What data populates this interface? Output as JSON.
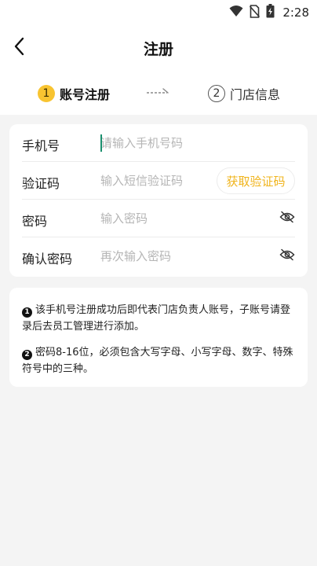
{
  "status_bar": {
    "time": "2:28",
    "icons": [
      "wifi-icon",
      "no-sim-icon",
      "battery-icon"
    ]
  },
  "header": {
    "title": "注册",
    "back_icon": "chevron-left-icon"
  },
  "steps": [
    {
      "number": "1",
      "label": "账号注册",
      "active": true
    },
    {
      "number": "2",
      "label": "门店信息",
      "active": false
    }
  ],
  "form": {
    "phone": {
      "label": "手机号",
      "placeholder": "请输入手机号码"
    },
    "code": {
      "label": "验证码",
      "placeholder": "输入短信验证码",
      "button": "获取验证码"
    },
    "password": {
      "label": "密码",
      "placeholder": "输入密码"
    },
    "confirm": {
      "label": "确认密码",
      "placeholder": "再次输入密码"
    }
  },
  "notes": [
    {
      "number": "1",
      "text": "该手机号注册成功后即代表门店负责人账号，子账号请登录后去员工管理进行添加。"
    },
    {
      "number": "2",
      "text": "密码8-16位，必须包含大写字母、小写字母、数字、特殊符号中的三种。"
    }
  ],
  "colors": {
    "accent": "#f8c431",
    "accent_text": "#f0b41c",
    "background": "#f4f4f4",
    "cursor": "#1a8f6e"
  }
}
